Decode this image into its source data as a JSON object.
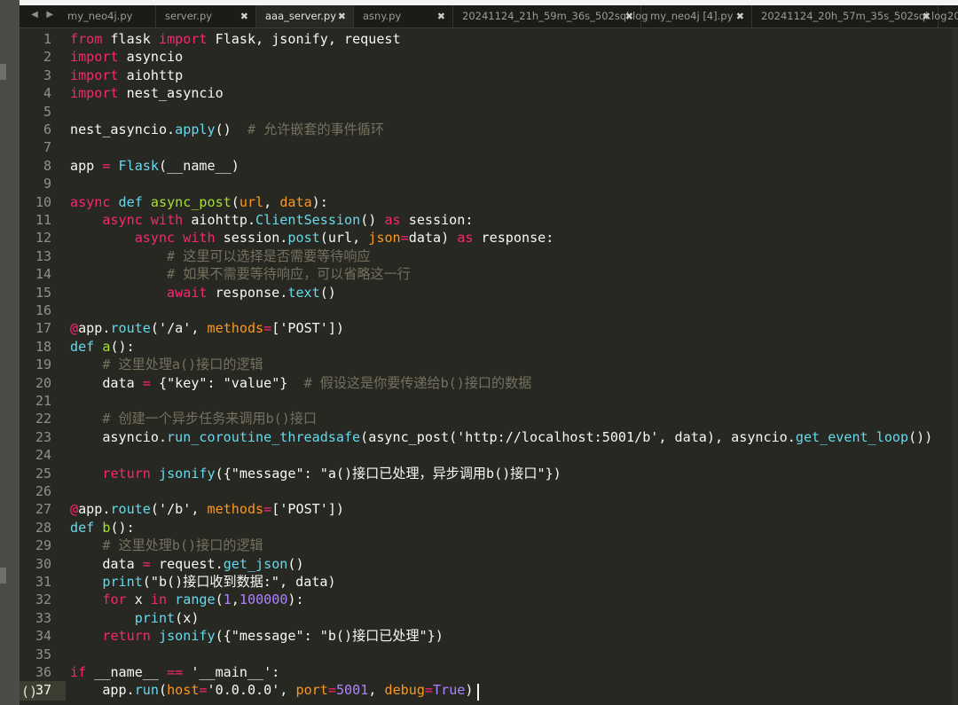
{
  "tabbar": {
    "prev_arrow": "◀",
    "next_arrow": "▶",
    "tabs": [
      {
        "label": "my_neo4j.py",
        "close": ""
      },
      {
        "label": "server.py",
        "close": "✖"
      },
      {
        "label": "aaa_server.py",
        "close": "✖",
        "active": true
      },
      {
        "label": "asny.py",
        "close": "✖"
      },
      {
        "label": "20241124_21h_59m_36s_502sql.log",
        "close": "✖"
      },
      {
        "label": "my_neo4j [4].py",
        "close": "✖"
      },
      {
        "label": "20241124_20h_57m_35s_502sql.log",
        "close": "✖"
      },
      {
        "label": "20",
        "close": ""
      }
    ]
  },
  "editor": {
    "current_line": 37,
    "current_line_marker": "()",
    "lines": [
      {
        "n": "1",
        "t": [
          [
            "from",
            "kw"
          ],
          [
            " flask ",
            "tx"
          ],
          [
            "import",
            "kw"
          ],
          [
            " Flask, jsonify, request",
            "tx"
          ]
        ]
      },
      {
        "n": "2",
        "t": [
          [
            "import",
            "kw"
          ],
          [
            " asyncio",
            "tx"
          ]
        ]
      },
      {
        "n": "3",
        "t": [
          [
            "import",
            "kw"
          ],
          [
            " aiohttp",
            "tx"
          ]
        ]
      },
      {
        "n": "4",
        "t": [
          [
            "import",
            "kw"
          ],
          [
            " nest_asyncio",
            "tx"
          ]
        ]
      },
      {
        "n": "5",
        "t": []
      },
      {
        "n": "6",
        "t": [
          [
            "nest_asyncio.",
            "tx"
          ],
          [
            "apply",
            "bi"
          ],
          [
            "()  ",
            "tx"
          ],
          [
            "# 允许嵌套的事件循环",
            "cm"
          ]
        ]
      },
      {
        "n": "7",
        "t": []
      },
      {
        "n": "8",
        "t": [
          [
            "app ",
            "tx"
          ],
          [
            "=",
            "kw"
          ],
          [
            " ",
            "tx"
          ],
          [
            "Flask",
            "bi"
          ],
          [
            "(__name__)",
            "tx"
          ]
        ]
      },
      {
        "n": "9",
        "t": []
      },
      {
        "n": "10",
        "t": [
          [
            "async",
            "kw"
          ],
          [
            " ",
            "tx"
          ],
          [
            "def",
            "bi"
          ],
          [
            " ",
            "tx"
          ],
          [
            "async_post",
            "fn"
          ],
          [
            "(",
            "tx"
          ],
          [
            "url",
            "pm"
          ],
          [
            ", ",
            "tx"
          ],
          [
            "data",
            "pm"
          ],
          [
            "):",
            "tx"
          ]
        ]
      },
      {
        "n": "11",
        "t": [
          [
            "    ",
            "tx"
          ],
          [
            "async",
            "kw"
          ],
          [
            " ",
            "tx"
          ],
          [
            "with",
            "kw"
          ],
          [
            " aiohttp.",
            "tx"
          ],
          [
            "ClientSession",
            "bi"
          ],
          [
            "() ",
            "tx"
          ],
          [
            "as",
            "kw"
          ],
          [
            " session:",
            "tx"
          ]
        ]
      },
      {
        "n": "12",
        "t": [
          [
            "        ",
            "tx"
          ],
          [
            "async",
            "kw"
          ],
          [
            " ",
            "tx"
          ],
          [
            "with",
            "kw"
          ],
          [
            " session.",
            "tx"
          ],
          [
            "post",
            "bi"
          ],
          [
            "(url, ",
            "tx"
          ],
          [
            "json",
            "pm"
          ],
          [
            "=",
            "kw"
          ],
          [
            "data) ",
            "tx"
          ],
          [
            "as",
            "kw"
          ],
          [
            " response:",
            "tx"
          ]
        ]
      },
      {
        "n": "13",
        "t": [
          [
            "            ",
            "tx"
          ],
          [
            "# 这里可以选择是否需要等待响应",
            "cm"
          ]
        ]
      },
      {
        "n": "14",
        "t": [
          [
            "            ",
            "tx"
          ],
          [
            "# 如果不需要等待响应，可以省略这一行",
            "cm"
          ]
        ]
      },
      {
        "n": "15",
        "t": [
          [
            "            ",
            "tx"
          ],
          [
            "await",
            "kw"
          ],
          [
            " response.",
            "tx"
          ],
          [
            "text",
            "bi"
          ],
          [
            "()",
            "tx"
          ]
        ]
      },
      {
        "n": "16",
        "t": []
      },
      {
        "n": "17",
        "t": [
          [
            "@",
            "kw"
          ],
          [
            "app.",
            "tx"
          ],
          [
            "route",
            "bi"
          ],
          [
            "('/a', ",
            "tx"
          ],
          [
            "methods",
            "pm"
          ],
          [
            "=",
            "kw"
          ],
          [
            "['POST'])",
            "tx"
          ]
        ]
      },
      {
        "n": "18",
        "t": [
          [
            "def",
            "bi"
          ],
          [
            " ",
            "tx"
          ],
          [
            "a",
            "fn"
          ],
          [
            "():",
            "tx"
          ]
        ]
      },
      {
        "n": "19",
        "t": [
          [
            "    ",
            "tx"
          ],
          [
            "# 这里处理a()接口的逻辑",
            "cm"
          ]
        ]
      },
      {
        "n": "20",
        "t": [
          [
            "    data ",
            "tx"
          ],
          [
            "=",
            "kw"
          ],
          [
            " {\"key\": \"value\"}  ",
            "tx"
          ],
          [
            "# 假设这是你要传递给b()接口的数据",
            "cm"
          ]
        ]
      },
      {
        "n": "21",
        "t": []
      },
      {
        "n": "22",
        "t": [
          [
            "    ",
            "tx"
          ],
          [
            "# 创建一个异步任务来调用b()接口",
            "cm"
          ]
        ]
      },
      {
        "n": "23",
        "t": [
          [
            "    asyncio.",
            "tx"
          ],
          [
            "run_coroutine_threadsafe",
            "bi"
          ],
          [
            "(async_post('http://localhost:5001/b', data), asyncio.",
            "tx"
          ],
          [
            "get_event_loop",
            "bi"
          ],
          [
            "())",
            "tx"
          ]
        ]
      },
      {
        "n": "24",
        "t": []
      },
      {
        "n": "25",
        "t": [
          [
            "    ",
            "tx"
          ],
          [
            "return",
            "kw"
          ],
          [
            " ",
            "tx"
          ],
          [
            "jsonify",
            "bi"
          ],
          [
            "({\"message\": \"a()接口已处理，异步调用b()接口\"})",
            "tx"
          ]
        ]
      },
      {
        "n": "26",
        "t": []
      },
      {
        "n": "27",
        "t": [
          [
            "@",
            "kw"
          ],
          [
            "app.",
            "tx"
          ],
          [
            "route",
            "bi"
          ],
          [
            "('/b', ",
            "tx"
          ],
          [
            "methods",
            "pm"
          ],
          [
            "=",
            "kw"
          ],
          [
            "['POST'])",
            "tx"
          ]
        ]
      },
      {
        "n": "28",
        "t": [
          [
            "def",
            "bi"
          ],
          [
            " ",
            "tx"
          ],
          [
            "b",
            "fn"
          ],
          [
            "():",
            "tx"
          ]
        ]
      },
      {
        "n": "29",
        "t": [
          [
            "    ",
            "tx"
          ],
          [
            "# 这里处理b()接口的逻辑",
            "cm"
          ]
        ]
      },
      {
        "n": "30",
        "t": [
          [
            "    data ",
            "tx"
          ],
          [
            "=",
            "kw"
          ],
          [
            " request.",
            "tx"
          ],
          [
            "get_json",
            "bi"
          ],
          [
            "()",
            "tx"
          ]
        ]
      },
      {
        "n": "31",
        "t": [
          [
            "    ",
            "tx"
          ],
          [
            "print",
            "bi"
          ],
          [
            "(\"b()接口收到数据:\", data)",
            "tx"
          ]
        ]
      },
      {
        "n": "32",
        "t": [
          [
            "    ",
            "tx"
          ],
          [
            "for",
            "kw"
          ],
          [
            " x ",
            "tx"
          ],
          [
            "in",
            "kw"
          ],
          [
            " ",
            "tx"
          ],
          [
            "range",
            "bi"
          ],
          [
            "(",
            "tx"
          ],
          [
            "1",
            "nu"
          ],
          [
            ",",
            "tx"
          ],
          [
            "100000",
            "nu"
          ],
          [
            "):",
            "tx"
          ]
        ]
      },
      {
        "n": "33",
        "t": [
          [
            "        ",
            "tx"
          ],
          [
            "print",
            "bi"
          ],
          [
            "(x)",
            "tx"
          ]
        ]
      },
      {
        "n": "34",
        "t": [
          [
            "    ",
            "tx"
          ],
          [
            "return",
            "kw"
          ],
          [
            " ",
            "tx"
          ],
          [
            "jsonify",
            "bi"
          ],
          [
            "({\"message\": \"b()接口已处理\"})",
            "tx"
          ]
        ]
      },
      {
        "n": "35",
        "t": []
      },
      {
        "n": "36",
        "t": [
          [
            "if",
            "kw"
          ],
          [
            " __name__ ",
            "tx"
          ],
          [
            "==",
            "kw"
          ],
          [
            " '__main__':",
            "tx"
          ]
        ]
      },
      {
        "n": "37",
        "t": [
          [
            "    app.",
            "tx"
          ],
          [
            "run",
            "bi"
          ],
          [
            "(",
            "tx"
          ],
          [
            "host",
            "pm"
          ],
          [
            "=",
            "kw"
          ],
          [
            "'0.0.0.0', ",
            "tx"
          ],
          [
            "port",
            "pm"
          ],
          [
            "=",
            "kw"
          ],
          [
            "5001",
            "nu"
          ],
          [
            ", ",
            "tx"
          ],
          [
            "debug",
            "pm"
          ],
          [
            "=",
            "kw"
          ],
          [
            "True",
            "nu"
          ],
          [
            ")",
            "tx"
          ]
        ]
      }
    ]
  }
}
